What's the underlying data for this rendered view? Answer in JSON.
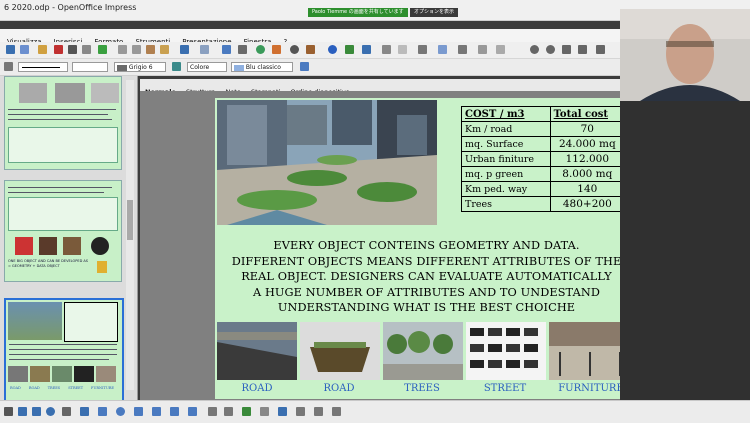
{
  "window": {
    "title": "6 2020.odp - OpenOffice Impress",
    "share_banner": "Paolo Tiemme の画面を共有しています",
    "share_options": "オプションを表示"
  },
  "menu": [
    "Visualizza",
    "Inserisci",
    "Formato",
    "Strumenti",
    "Presentazione",
    "Finestra",
    "?"
  ],
  "format_bar": {
    "line_color": "Grigio 6",
    "area_mode": "Colore",
    "area_color": "Blu classico"
  },
  "view_tabs": [
    "Normale",
    "Struttura",
    "Note",
    "Stampati",
    "Ordine diapositive"
  ],
  "slide": {
    "table": {
      "headers": [
        "COST / m3",
        "Total cost"
      ],
      "rows": [
        {
          "label": "Km / road",
          "value": "70"
        },
        {
          "label": "mq. Surface",
          "value": "24.000 mq"
        },
        {
          "label": "Urban finiture",
          "value": "112.000"
        },
        {
          "label": "mq. p green",
          "value": "8.000 mq"
        },
        {
          "label": "Km ped. way",
          "value": "140"
        },
        {
          "label": "Trees",
          "value": "480+200"
        }
      ]
    },
    "body_lines": [
      "EVERY OBJECT CONTEINS GEOMETRY AND DATA.",
      "DIFFERENT OBJECTS MEANS DIFFERENT ATTRIBUTES OF THE",
      "REAL OBJECT. DESIGNERS CAN EVALUATE AUTOMATICALLY",
      "A HUGE NUMBER OF ATTRIBUTES AND TO UNDESTAND",
      "UNDERSTANDING WHAT IS THE BEST CHOICHE"
    ],
    "captions": [
      "ROAD",
      "ROAD",
      "TREES",
      "STREET",
      "FURNITURE"
    ]
  },
  "thumbnails": {
    "t2_text": "ONE BIG OBJECT AND CAN BE DEVELOPED AS = GEOMETRY + DATA OBJECT",
    "t3_captions": [
      "ROAD",
      "ROAD",
      "TREES",
      "STREET",
      "FURNITURE"
    ]
  },
  "colors": {
    "slide_bg": "#c9f2c9",
    "caption_blue": "#2a5fbf",
    "share_green": "#2d8f2d"
  }
}
